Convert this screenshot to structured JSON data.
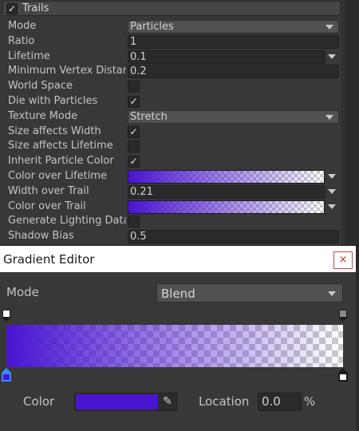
{
  "module": {
    "title": "Trails",
    "enabled_glyph": "✓"
  },
  "properties": [
    {
      "label": "Mode",
      "type": "dropdown",
      "value": "Particles"
    },
    {
      "label": "Ratio",
      "type": "field",
      "value": "1"
    },
    {
      "label": "Lifetime",
      "type": "field-curve",
      "value": "0.1"
    },
    {
      "label": "Minimum Vertex Distance",
      "type": "field",
      "value": "0.2"
    },
    {
      "label": "World Space",
      "type": "toggle",
      "value": ""
    },
    {
      "label": "Die with Particles",
      "type": "toggle",
      "value": "✓"
    },
    {
      "label": "Texture Mode",
      "type": "dropdown",
      "value": "Stretch"
    },
    {
      "label": "Size affects Width",
      "type": "toggle",
      "value": "✓"
    },
    {
      "label": "Size affects Lifetime",
      "type": "toggle",
      "value": ""
    },
    {
      "label": "Inherit Particle Color",
      "type": "toggle",
      "value": "✓"
    },
    {
      "label": "Color over Lifetime",
      "type": "gradient",
      "value": ""
    },
    {
      "label": "Width over Trail",
      "type": "field-curve",
      "value": "0.21"
    },
    {
      "label": "Color over Trail",
      "type": "gradient",
      "value": ""
    },
    {
      "label": "Generate Lighting Data",
      "type": "toggle",
      "value": ""
    },
    {
      "label": "Shadow Bias",
      "type": "field",
      "value": "0.5"
    }
  ],
  "gradient_editor": {
    "title": "Gradient Editor",
    "close_glyph": "×",
    "mode_label": "Mode",
    "mode_value": "Blend",
    "color_label": "Color",
    "location_label": "Location",
    "location_value": "0.0",
    "location_unit": "%",
    "picker_glyph": "✎",
    "key_color": "#4a14d2",
    "gradient_start": "#4a14d2",
    "gradient_end": "rgba(74,20,210,0)",
    "alpha_keys": [
      {
        "location": 0,
        "color": "#ffffff"
      },
      {
        "location": 100,
        "color": "#8a8a8a"
      }
    ],
    "color_keys": [
      {
        "location": 0,
        "color": "#4a14d2",
        "selected": true
      },
      {
        "location": 100,
        "color": "#ffffff",
        "selected": false
      }
    ]
  }
}
